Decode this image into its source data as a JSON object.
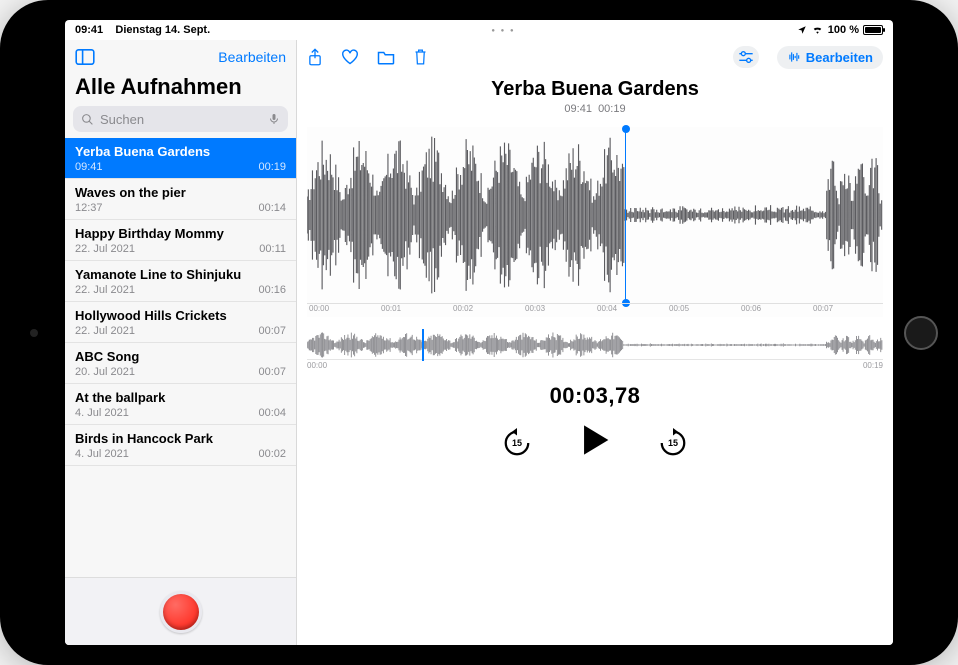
{
  "statusbar": {
    "time": "09:41",
    "date": "Dienstag 14. Sept.",
    "battery_pct": "100 %"
  },
  "sidebar": {
    "edit_label": "Bearbeiten",
    "title": "Alle Aufnahmen",
    "search_placeholder": "Suchen",
    "items": [
      {
        "title": "Yerba Buena Gardens",
        "date": "09:41",
        "duration": "00:19"
      },
      {
        "title": "Waves on the pier",
        "date": "12:37",
        "duration": "00:14"
      },
      {
        "title": "Happy Birthday Mommy",
        "date": "22. Jul 2021",
        "duration": "00:11"
      },
      {
        "title": "Yamanote Line to Shinjuku",
        "date": "22. Jul 2021",
        "duration": "00:16"
      },
      {
        "title": "Hollywood Hills Crickets",
        "date": "22. Jul 2021",
        "duration": "00:07"
      },
      {
        "title": "ABC Song",
        "date": "20. Jul 2021",
        "duration": "00:07"
      },
      {
        "title": "At the ballpark",
        "date": "4. Jul 2021",
        "duration": "00:04"
      },
      {
        "title": "Birds in Hancock Park",
        "date": "4. Jul 2021",
        "duration": "00:02"
      }
    ]
  },
  "main": {
    "edit_label": "Bearbeiten",
    "rec_title": "Yerba Buena Gardens",
    "rec_time": "09:41",
    "rec_duration": "00:19",
    "timeline_ticks": [
      "00:00",
      "00:01",
      "00:02",
      "00:03",
      "00:04",
      "00:05",
      "00:06",
      "00:07"
    ],
    "mini_start": "00:00",
    "mini_end": "00:19",
    "current_time": "00:03,78",
    "skip_back": "15",
    "skip_fwd": "15"
  }
}
